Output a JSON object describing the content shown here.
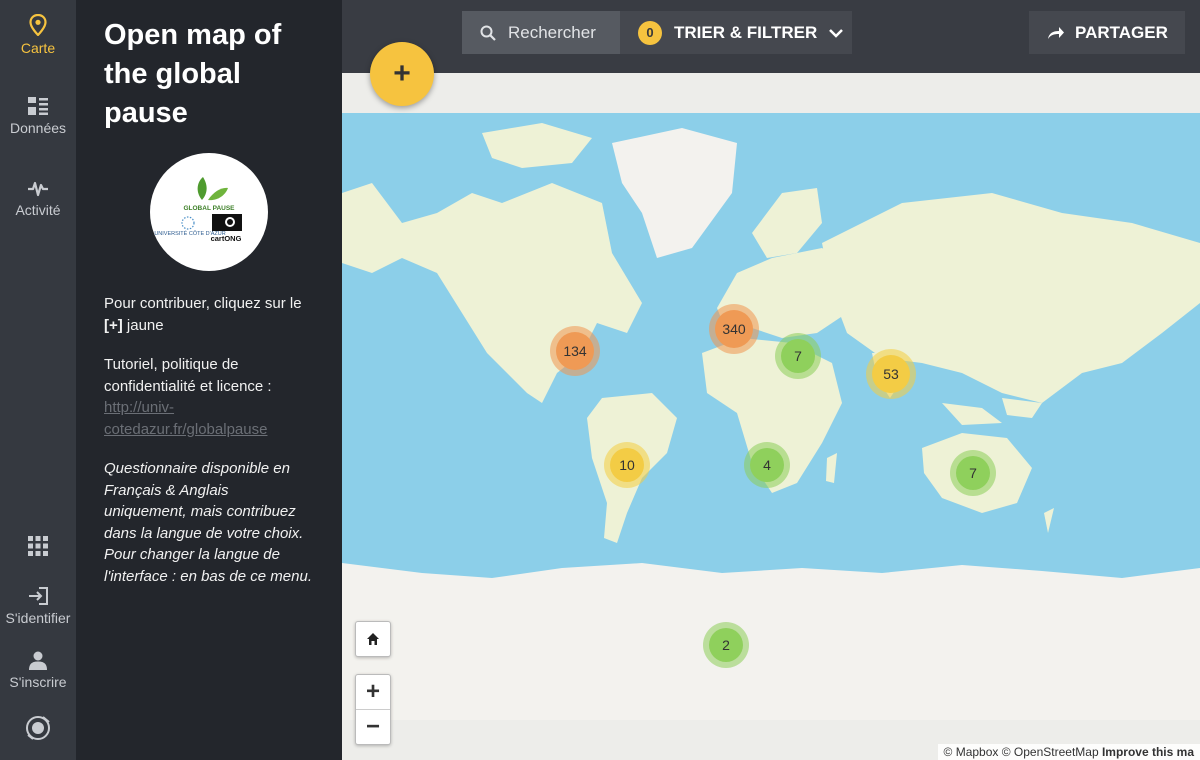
{
  "rail": {
    "map_label": "Carte",
    "data_label": "Données",
    "activity_label": "Activité",
    "login_label": "S'identifier",
    "signup_label": "S'inscrire"
  },
  "panel": {
    "title": "Open map of the global pause",
    "logo_text": "GLOBAL PAUSE",
    "logo_univ": "UNIVERSITÉ CÔTE D'AZUR",
    "logo_cartong": "cartONG",
    "contribute_prefix": "Pour contribuer, cliquez sur le ",
    "contribute_plus": "[+]",
    "contribute_suffix": " jaune",
    "tutorial_text": "Tutoriel, politique de confidentialité et licence :",
    "tutorial_link": "http://univ-cotedazur.fr/globalpause",
    "language_note": "Questionnaire disponible en Français & Anglais uniquement, mais contribuez dans la langue de votre choix. Pour changer la langue de l'interface : en bas de ce menu."
  },
  "topbar": {
    "search_label": "Rechercher",
    "filter_count": "0",
    "filter_label": "TRIER & FILTRER",
    "share_label": "PARTAGER"
  },
  "map": {
    "add_label": "+",
    "zoom_in": "+",
    "zoom_out": "−",
    "attribution_prefix": "© Mapbox © OpenStreetMap",
    "attribution_link": "Improve this ma",
    "colors": {
      "ocean": "#8ccfe9",
      "land": "#eef2d6",
      "ice": "#f3f2ee",
      "accent": "#f6c33f"
    },
    "clusters": [
      {
        "count": "134",
        "color": "orange"
      },
      {
        "count": "340",
        "color": "orange"
      },
      {
        "count": "7",
        "color": "green"
      },
      {
        "count": "53",
        "color": "yellow"
      },
      {
        "count": "10",
        "color": "yellow"
      },
      {
        "count": "4",
        "color": "green"
      },
      {
        "count": "7",
        "color": "green"
      },
      {
        "count": "2",
        "color": "green"
      }
    ]
  }
}
